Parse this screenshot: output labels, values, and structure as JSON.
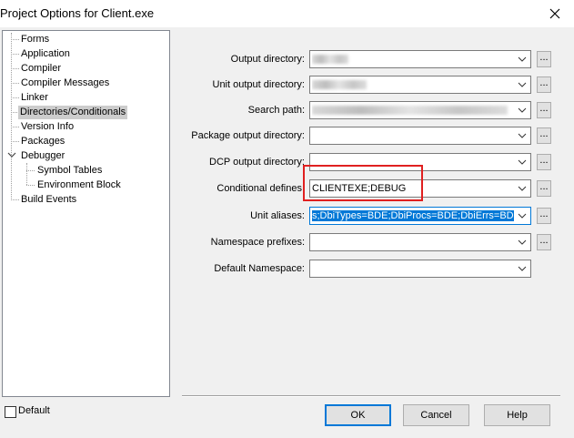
{
  "window": {
    "title": "Project Options for Client.exe"
  },
  "tree": {
    "items": [
      {
        "label": "Forms"
      },
      {
        "label": "Application"
      },
      {
        "label": "Compiler"
      },
      {
        "label": "Compiler Messages"
      },
      {
        "label": "Linker"
      },
      {
        "label": "Directories/Conditionals",
        "selected": true
      },
      {
        "label": "Version Info"
      },
      {
        "label": "Packages"
      },
      {
        "label": "Debugger",
        "expanded": true
      },
      {
        "label": "Symbol Tables"
      },
      {
        "label": "Environment Block"
      },
      {
        "label": "Build Events"
      }
    ]
  },
  "fields": [
    {
      "label": "Output directory:",
      "value": "",
      "browse": "..."
    },
    {
      "label": "Unit output directory:",
      "value": "",
      "browse": "..."
    },
    {
      "label": "Search path:",
      "value": "",
      "browse": "..."
    },
    {
      "label": "Package output directory:",
      "value": "",
      "browse": "..."
    },
    {
      "label": "DCP output directory:",
      "value": "",
      "browse": "..."
    },
    {
      "label": "Conditional defines:",
      "value": "CLIENTEXE;DEBUG",
      "browse": "..."
    },
    {
      "label": "Unit aliases:",
      "value": "s;DbiTypes=BDE;DbiProcs=BDE;DbiErrs=BDE;",
      "browse": "..."
    },
    {
      "label": "Namespace prefixes:",
      "value": "",
      "browse": "..."
    },
    {
      "label": "Default Namespace:",
      "value": ""
    }
  ],
  "footer": {
    "default_label": "Default",
    "ok_label": "OK",
    "cancel_label": "Cancel",
    "help_label": "Help"
  },
  "colors": {
    "focus_accent": "#0078d7",
    "highlight_box": "#e02020"
  }
}
